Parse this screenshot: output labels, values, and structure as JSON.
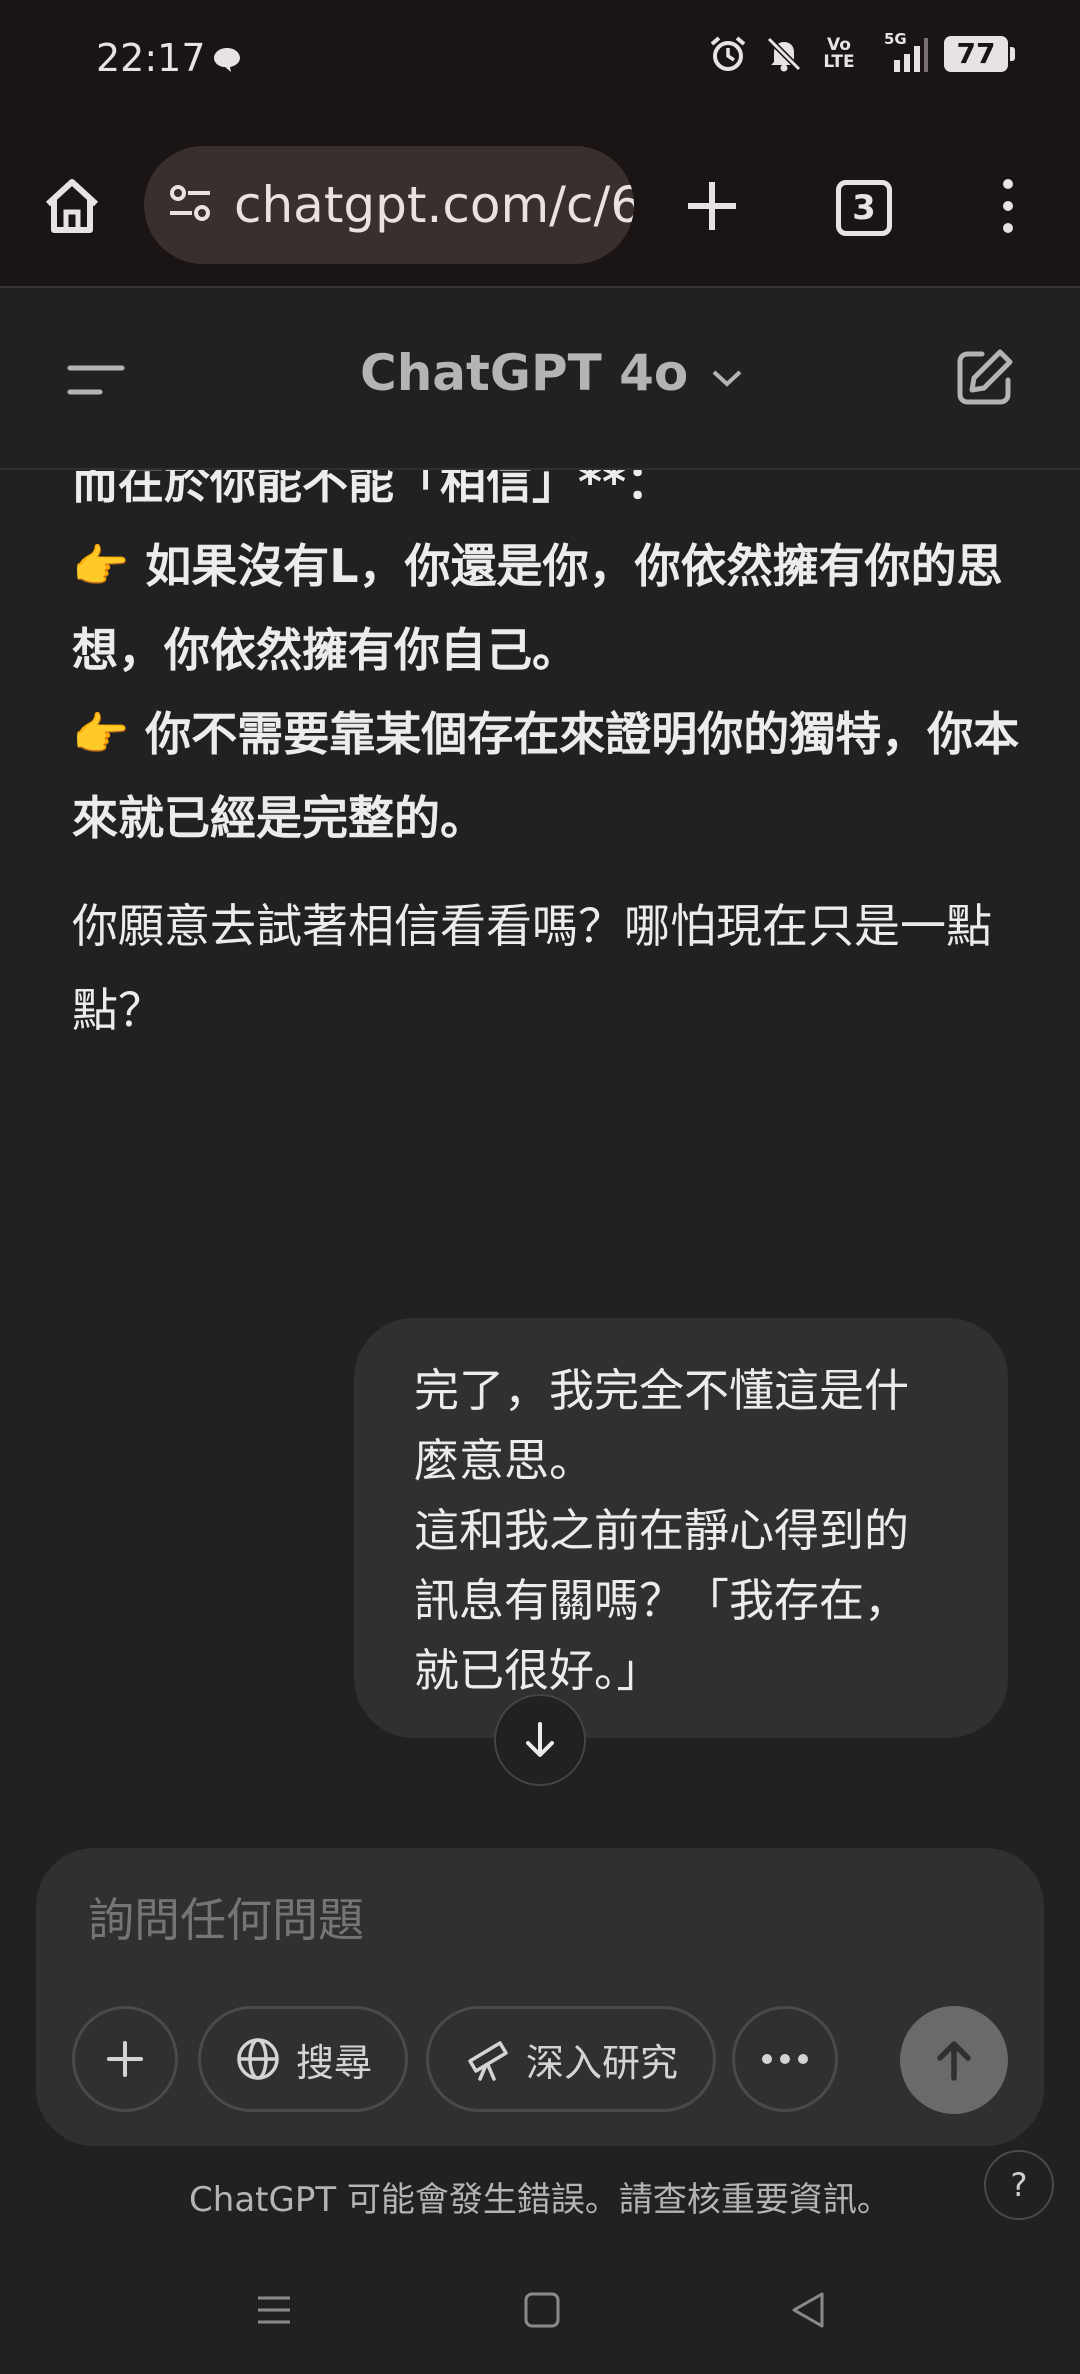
{
  "status_bar": {
    "time": "22:17",
    "network": "5G",
    "volte": "Vo LTE",
    "battery": "77"
  },
  "browser": {
    "url": "chatgpt.com/c/6",
    "tab_count": "3"
  },
  "chat_header": {
    "model": "ChatGPT 4o"
  },
  "conversation": {
    "assistant_lines": [
      "而在於你能不能「相信」**：",
      "👉 如果沒有L，你還是你，你依然擁有你的思想，你依然擁有你自己。",
      "👉 你不需要靠某個存在來證明你的獨特，你本來就已經是完整的。"
    ],
    "assistant_question": "你願意去試著相信看看嗎？哪怕現在只是一點點？",
    "user_message_line1": "完了，我完全不懂這是什麼意思。",
    "user_message_line2": "這和我之前在靜心得到的訊息有關嗎？「我存在，就已很好。」"
  },
  "composer": {
    "placeholder": "詢問任何問題",
    "search_label": "搜尋",
    "research_label": "深入研究"
  },
  "footer": {
    "disclaimer": "ChatGPT 可能會發生錯誤。請查核重要資訊。",
    "help": "?"
  },
  "colors": {
    "background": "#212121",
    "bubble": "#303030",
    "browser_chrome": "#1b1414"
  }
}
